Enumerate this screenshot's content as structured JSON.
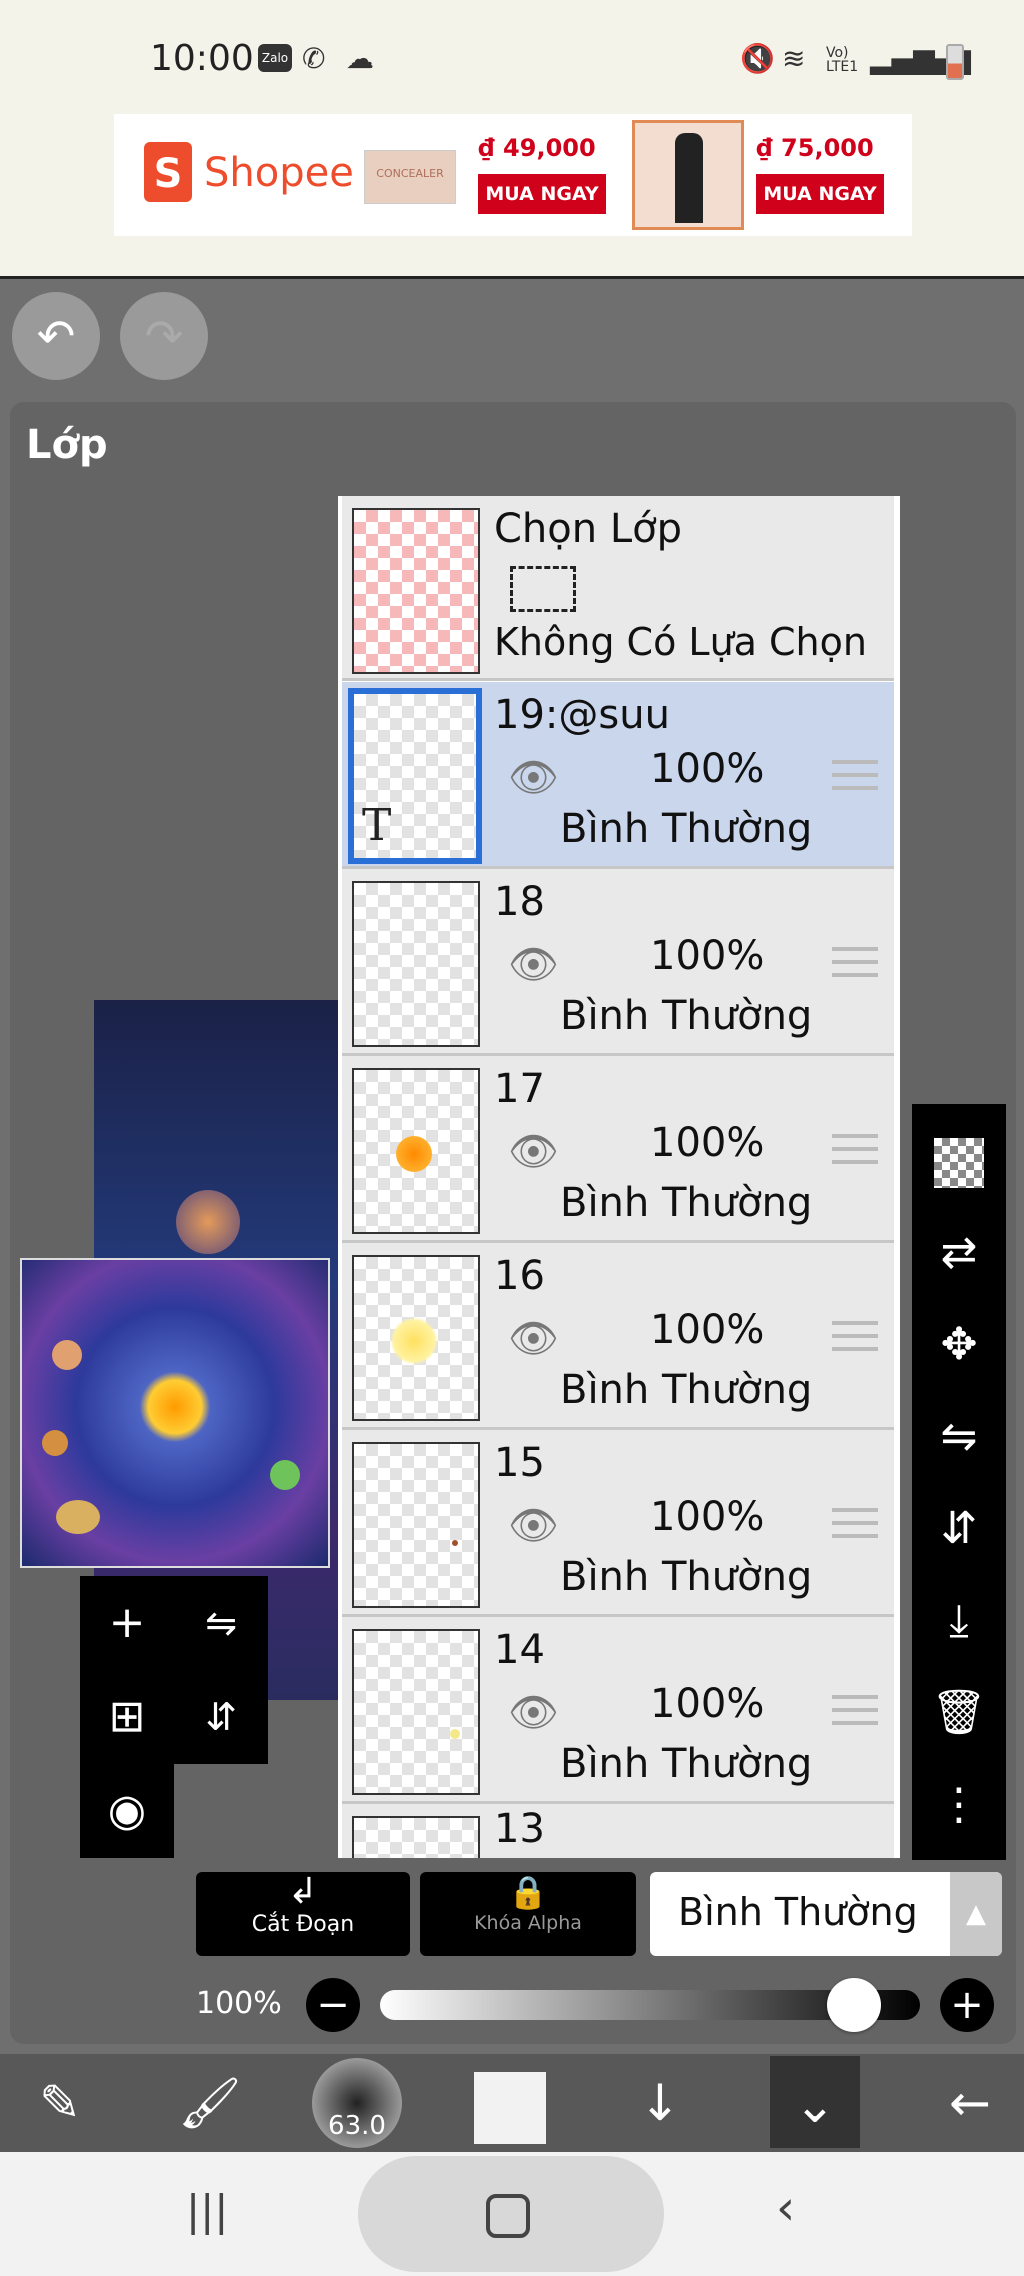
{
  "status_bar": {
    "time": "10:00",
    "app_icons": [
      "zalo-icon",
      "viber-icon",
      "cloud-icon"
    ],
    "network_label": "Vo) LTE1"
  },
  "ad": {
    "brand": "Shopee",
    "product1_price": "₫ 49,000",
    "product2_price": "₫ 75,000",
    "buy_label": "MUA NGAY",
    "product1_text": "CONCEALER"
  },
  "panel": {
    "title": "Lớp"
  },
  "selection_layer": {
    "title": "Chọn Lớp",
    "status": "Không Có Lựa Chọn"
  },
  "layers": [
    {
      "name": "19:@suu",
      "opacity": "100%",
      "mode": "Bình Thường",
      "selected": true
    },
    {
      "name": "18",
      "opacity": "100%",
      "mode": "Bình Thường",
      "selected": false
    },
    {
      "name": "17",
      "opacity": "100%",
      "mode": "Bình Thường",
      "selected": false
    },
    {
      "name": "16",
      "opacity": "100%",
      "mode": "Bình Thường",
      "selected": false
    },
    {
      "name": "15",
      "opacity": "100%",
      "mode": "Bình Thường",
      "selected": false
    },
    {
      "name": "14",
      "opacity": "100%",
      "mode": "Bình Thường",
      "selected": false
    },
    {
      "name": "13",
      "opacity": "",
      "mode": "",
      "selected": false
    }
  ],
  "text_layer_glyph": "T",
  "controls": {
    "clip_label": "Cắt Đoạn",
    "alpha_lock_label": "Khóa Alpha",
    "blend_mode": "Bình Thường",
    "opacity_label": "100%",
    "opacity_value": 0.92
  },
  "toolbar": {
    "brush_size": "63.0"
  },
  "colors": {
    "ad_red": "#d0011b",
    "shopee_orange": "#ee4d2d",
    "selected_layer_bg": "#c9d6ec",
    "selected_border": "#2a6fd6"
  }
}
